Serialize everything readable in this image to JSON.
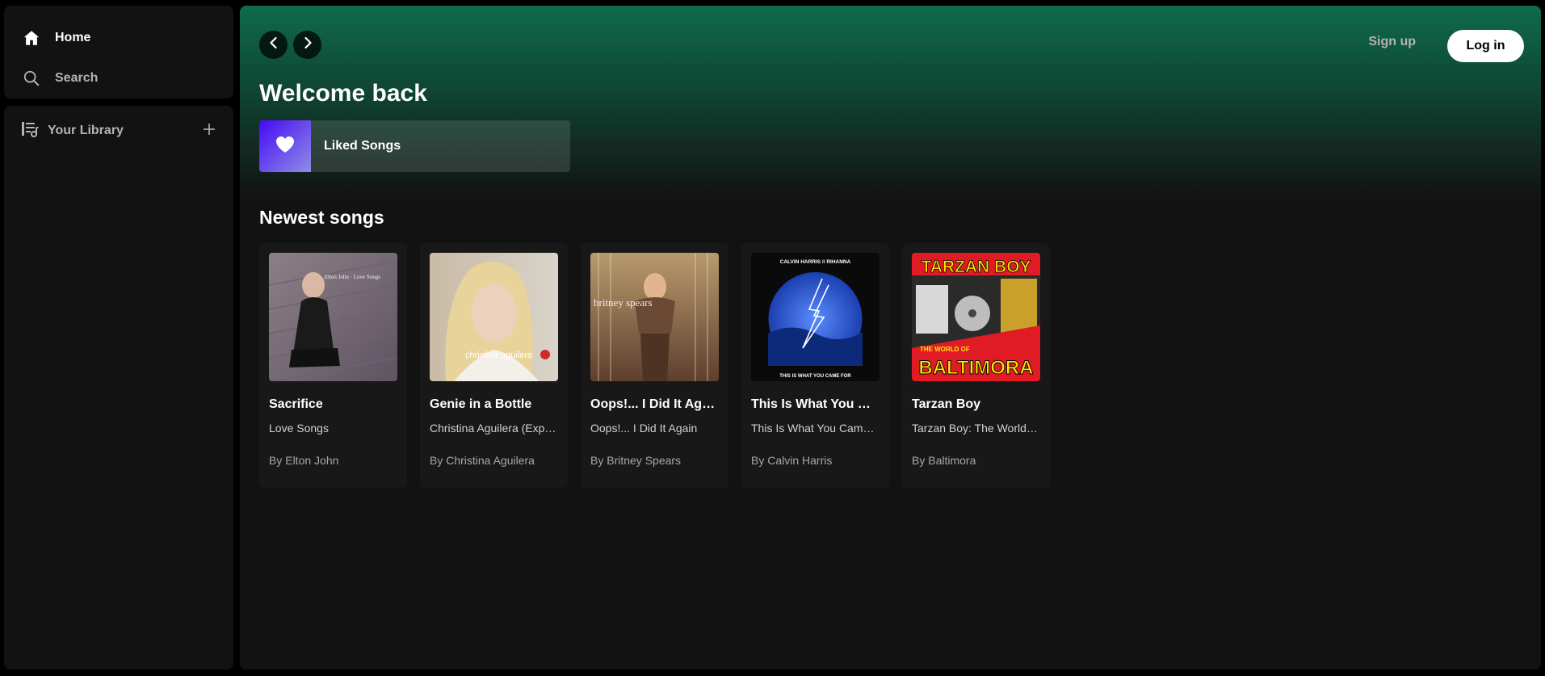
{
  "sidebar": {
    "nav": [
      {
        "label": "Home",
        "icon": "home-icon"
      },
      {
        "label": "Search",
        "icon": "search-icon"
      }
    ],
    "library": {
      "label": "Your Library",
      "icon": "library-icon",
      "add_icon": "plus-icon"
    }
  },
  "header": {
    "back_icon": "chevron-left-icon",
    "forward_icon": "chevron-right-icon",
    "signup_label": "Sign up",
    "login_label": "Log in"
  },
  "main": {
    "greeting": "Welcome back",
    "liked_songs": {
      "label": "Liked Songs",
      "icon": "heart-icon"
    },
    "section_title": "Newest songs",
    "songs": [
      {
        "title": "Sacrifice",
        "album": "Love Songs",
        "artist": "By Elton John",
        "cover_text": "Elton John · Love Songs"
      },
      {
        "title": "Genie in a Bottle",
        "album": "Christina Aguilera (Expanded Edition)",
        "artist": "By Christina Aguilera",
        "cover_text": "christina aguilera"
      },
      {
        "title": "Oops!... I Did It Again",
        "album": "Oops!... I Did It Again",
        "artist": "By Britney Spears",
        "cover_text": "britney spears"
      },
      {
        "title": "This Is What You Came For",
        "album": "This Is What You Came For",
        "artist": "By Calvin Harris",
        "cover_text_top": "CALVIN HARRIS // RIHANNA",
        "cover_text_bottom": "THIS IS WHAT YOU CAME FOR"
      },
      {
        "title": "Tarzan Boy",
        "album": "Tarzan Boy: The World of Baltimora",
        "artist": "By Baltimora",
        "cover_text_top": "TARZAN BOY",
        "cover_text_mid": "THE WORLD OF",
        "cover_text_bottom": "BALTIMORA"
      }
    ]
  },
  "colors": {
    "accent_green": "#0f6b4a",
    "background": "#121212",
    "card": "#181818"
  }
}
